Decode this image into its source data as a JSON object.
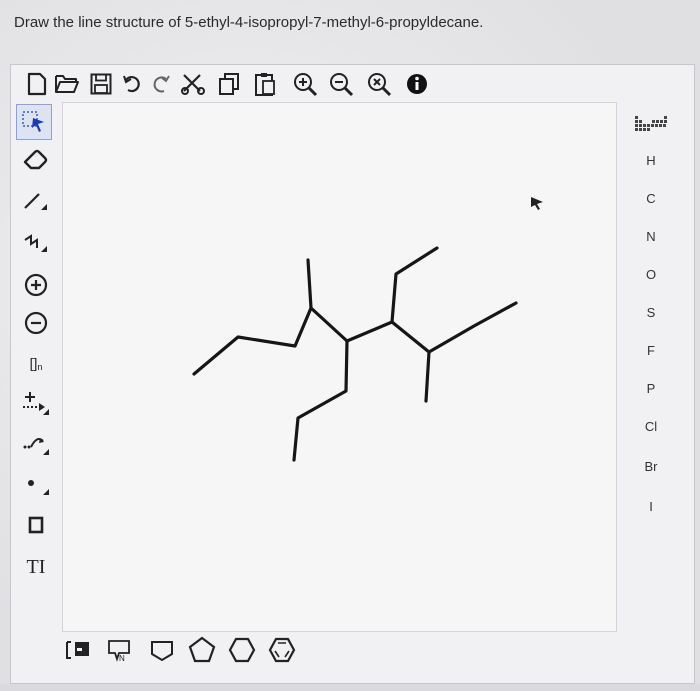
{
  "question": "Draw the line structure of 5-ethyl-4-isopropyl-7-methyl-6-propyldecane.",
  "toolbar": [
    {
      "name": "new-icon"
    },
    {
      "name": "open-icon"
    },
    {
      "name": "save-icon"
    },
    {
      "name": "undo-icon"
    },
    {
      "name": "redo-icon"
    },
    {
      "name": "cut-icon"
    },
    {
      "name": "copy-icon"
    },
    {
      "name": "paste-icon"
    },
    {
      "name": "zoom-in-icon"
    },
    {
      "name": "zoom-out-icon"
    },
    {
      "name": "zoom-reset-icon"
    },
    {
      "name": "info-icon"
    }
  ],
  "left_tools": {
    "bracket_label": "[]",
    "bracket_subscript": "n",
    "text_tool_label": "TI"
  },
  "atoms": [
    "H",
    "C",
    "N",
    "O",
    "S",
    "F",
    "P",
    "Cl",
    "Br",
    "I"
  ],
  "bottom_tools": [
    {
      "name": "chain-tool-icon"
    },
    {
      "name": "ring-tool-icon"
    },
    {
      "name": "cyclobutane-icon"
    },
    {
      "name": "cyclopentane-icon"
    },
    {
      "name": "cyclohexane-icon"
    },
    {
      "name": "benzene-icon"
    }
  ]
}
